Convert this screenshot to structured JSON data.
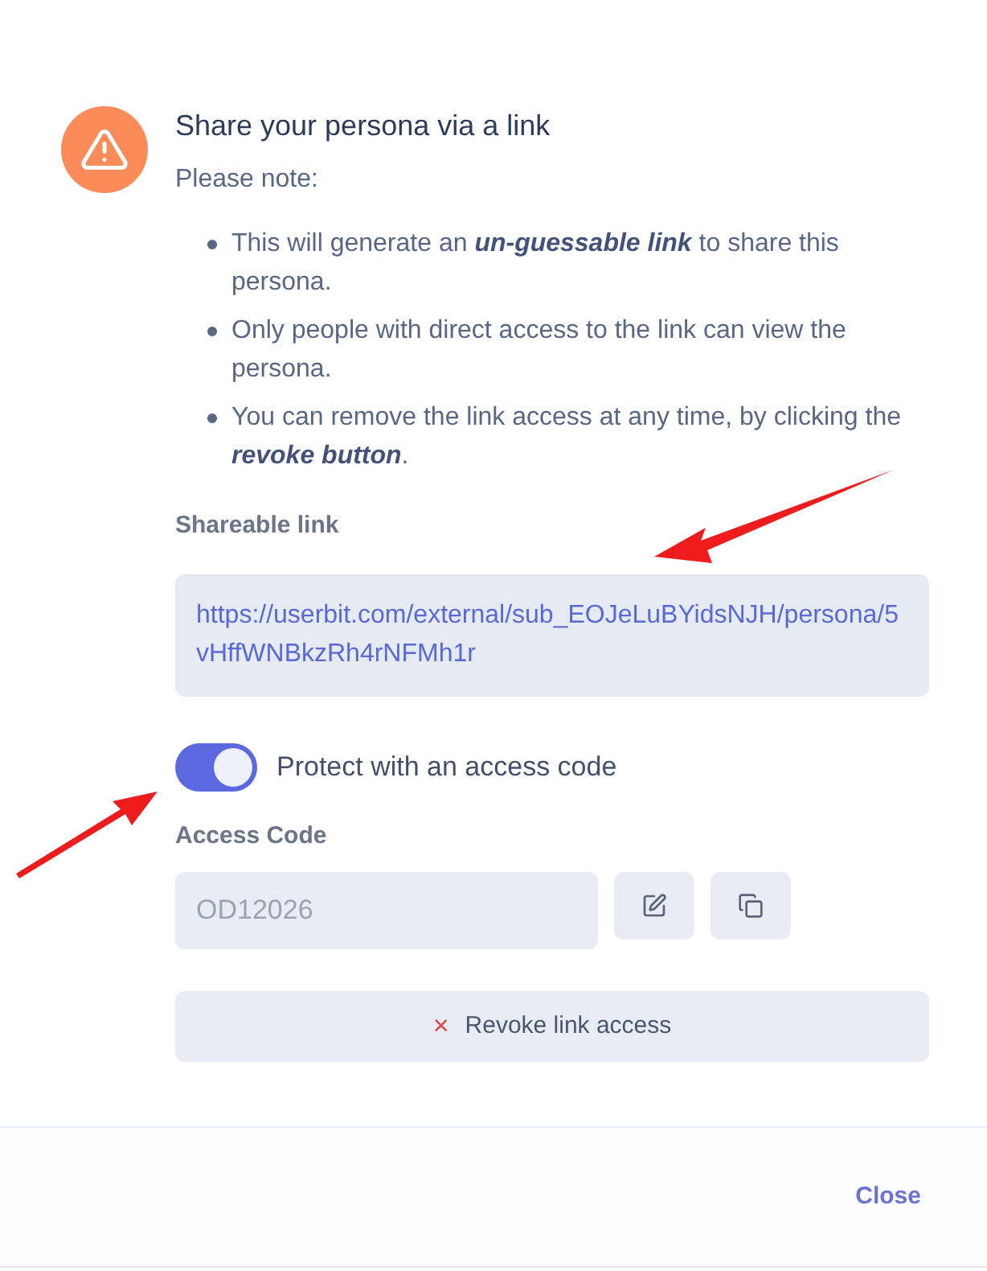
{
  "dialog": {
    "title": "Share your persona via a link",
    "intro": "Please note:",
    "notes": [
      "This will generate an **un-guessable link** to share this persona.",
      "Only people with direct access to the link can view the persona.",
      "You can remove the link access at any time, by clicking the **revoke button**."
    ],
    "link_label": "Shareable link",
    "link": "https://userbit.com/external/sub_EOJeLuBYidsNJH/persona/5vHffWNBkzRh4rNFMh1r",
    "protect": {
      "label": "Protect with an access code",
      "on": true
    },
    "access_code": {
      "label": "Access Code",
      "placeholder": "OD12026"
    },
    "revoke": {
      "icon": "×",
      "label": "Revoke link access"
    },
    "close": "Close"
  }
}
